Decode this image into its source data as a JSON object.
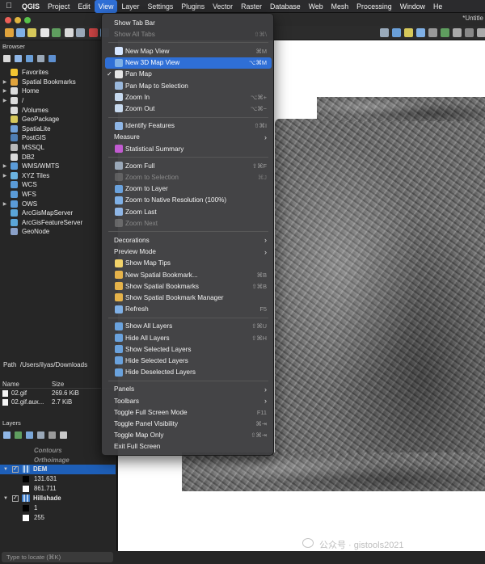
{
  "menubar": {
    "apple": "",
    "items": [
      "QGIS",
      "Project",
      "Edit",
      "View",
      "Layer",
      "Settings",
      "Plugins",
      "Vector",
      "Raster",
      "Database",
      "Web",
      "Mesh",
      "Processing",
      "Window",
      "He"
    ]
  },
  "window": {
    "title": "*Untitle"
  },
  "browser": {
    "title": "Browser",
    "items": [
      {
        "label": "Favorites",
        "arrow": "",
        "icon": "star-icon",
        "color": "#f3c531"
      },
      {
        "label": "Spatial Bookmarks",
        "arrow": "▶",
        "icon": "bookmark-icon",
        "color": "#e0a33c"
      },
      {
        "label": "Home",
        "arrow": "▶",
        "icon": "home-folder-icon",
        "color": "#dcdcdc"
      },
      {
        "label": "/",
        "arrow": "▶",
        "icon": "folder-icon",
        "color": "#dcdcdc"
      },
      {
        "label": "/Volumes",
        "arrow": "",
        "icon": "folder-icon",
        "color": "#dcdcdc"
      },
      {
        "label": "GeoPackage",
        "arrow": "",
        "icon": "geopackage-icon",
        "color": "#d6c85a"
      },
      {
        "label": "SpatiaLite",
        "arrow": "",
        "icon": "spatialite-icon",
        "color": "#6fa0d8"
      },
      {
        "label": "PostGIS",
        "arrow": "",
        "icon": "postgis-icon",
        "color": "#4f7fb5"
      },
      {
        "label": "MSSQL",
        "arrow": "",
        "icon": "mssql-icon",
        "color": "#b9b9b9"
      },
      {
        "label": "DB2",
        "arrow": "",
        "icon": "db2-icon",
        "color": "#d9d9d9"
      },
      {
        "label": "WMS/WMTS",
        "arrow": "▶",
        "icon": "wms-icon",
        "color": "#5a9bd8"
      },
      {
        "label": "XYZ Tiles",
        "arrow": "▶",
        "icon": "xyz-tiles-icon",
        "color": "#6bb3e0"
      },
      {
        "label": "WCS",
        "arrow": "",
        "icon": "wcs-icon",
        "color": "#5a9bd8"
      },
      {
        "label": "WFS",
        "arrow": "",
        "icon": "wfs-icon",
        "color": "#5a9bd8"
      },
      {
        "label": "OWS",
        "arrow": "▶",
        "icon": "ows-icon",
        "color": "#5a9bd8"
      },
      {
        "label": "ArcGisMapServer",
        "arrow": "",
        "icon": "arcgis-icon",
        "color": "#5aa5d8"
      },
      {
        "label": "ArcGisFeatureServer",
        "arrow": "",
        "icon": "arcgis-icon",
        "color": "#5aa5d8"
      },
      {
        "label": "GeoNode",
        "arrow": "",
        "icon": "geonode-icon",
        "color": "#8aa0c8"
      }
    ]
  },
  "path": {
    "label": "Path",
    "value": "/Users/ilyas/Downloads"
  },
  "files": {
    "headers": [
      "Name",
      "Size"
    ],
    "rows": [
      {
        "name": "02.gif",
        "size": "269.6 KiB"
      },
      {
        "name": "02.gif.aux...",
        "size": "2.7 KiB"
      }
    ]
  },
  "layers": {
    "title": "Layers",
    "rows": [
      {
        "label": "Contours",
        "type": "disabled"
      },
      {
        "label": "Orthoimage",
        "type": "disabled"
      },
      {
        "label": "DEM",
        "type": "raster-selected"
      },
      {
        "label": "131.631",
        "type": "legend",
        "color": "#000000"
      },
      {
        "label": "861.711",
        "type": "legend",
        "color": "#ffffff"
      },
      {
        "label": "Hillshade",
        "type": "raster"
      },
      {
        "label": "1",
        "type": "legend",
        "color": "#000000"
      },
      {
        "label": "255",
        "type": "legend",
        "color": "#ffffff"
      }
    ]
  },
  "locator": {
    "placeholder": "Type to locate (⌘K)"
  },
  "watermark": "公众号 · gistools2021",
  "viewMenu": {
    "items": [
      {
        "label": "Show Tab Bar",
        "shortcut": "",
        "enabled": true
      },
      {
        "label": "Show All Tabs",
        "shortcut": "⇧⌘\\",
        "enabled": false
      },
      {
        "sep": true
      },
      {
        "label": "New Map View",
        "shortcut": "⌘M",
        "enabled": true,
        "icon": "new-map-view-icon"
      },
      {
        "label": "New 3D Map View",
        "shortcut": "⌥⌘M",
        "enabled": true,
        "icon": "new-3d-map-view-icon",
        "highlight": true
      },
      {
        "label": "Pan Map",
        "shortcut": "",
        "enabled": true,
        "icon": "pan-hand-icon",
        "checked": true
      },
      {
        "label": "Pan Map to Selection",
        "shortcut": "",
        "enabled": true,
        "icon": "pan-to-selection-icon"
      },
      {
        "label": "Zoom In",
        "shortcut": "⌥⌘+",
        "enabled": true,
        "icon": "zoom-in-icon"
      },
      {
        "label": "Zoom Out",
        "shortcut": "⌥⌘−",
        "enabled": true,
        "icon": "zoom-out-icon"
      },
      {
        "sep": true
      },
      {
        "label": "Identify Features",
        "shortcut": "⇧⌘I",
        "enabled": true,
        "icon": "identify-icon"
      },
      {
        "label": "Measure",
        "submenu": true,
        "enabled": true
      },
      {
        "label": "Statistical Summary",
        "shortcut": "",
        "enabled": true,
        "icon": "statistics-icon"
      },
      {
        "sep": true
      },
      {
        "label": "Zoom Full",
        "shortcut": "⇧⌘F",
        "enabled": true,
        "icon": "zoom-full-icon"
      },
      {
        "label": "Zoom to Selection",
        "shortcut": "⌘J",
        "enabled": false,
        "icon": "zoom-to-selection-icon"
      },
      {
        "label": "Zoom to Layer",
        "shortcut": "",
        "enabled": true,
        "icon": "zoom-to-layer-icon"
      },
      {
        "label": "Zoom to Native Resolution (100%)",
        "shortcut": "",
        "enabled": true,
        "icon": "zoom-native-icon"
      },
      {
        "label": "Zoom Last",
        "shortcut": "",
        "enabled": true,
        "icon": "zoom-last-icon"
      },
      {
        "label": "Zoom Next",
        "shortcut": "",
        "enabled": false,
        "icon": "zoom-next-icon"
      },
      {
        "sep": true
      },
      {
        "label": "Decorations",
        "submenu": true,
        "enabled": true
      },
      {
        "label": "Preview Mode",
        "submenu": true,
        "enabled": true
      },
      {
        "label": "Show Map Tips",
        "shortcut": "",
        "enabled": true,
        "icon": "map-tips-icon"
      },
      {
        "label": "New Spatial Bookmark...",
        "shortcut": "⌘B",
        "enabled": true,
        "icon": "new-bookmark-icon"
      },
      {
        "label": "Show Spatial Bookmarks",
        "shortcut": "⇧⌘B",
        "enabled": true,
        "icon": "show-bookmarks-icon"
      },
      {
        "label": "Show Spatial Bookmark Manager",
        "shortcut": "",
        "enabled": true,
        "icon": "bookmark-manager-icon"
      },
      {
        "label": "Refresh",
        "shortcut": "F5",
        "enabled": true,
        "icon": "refresh-icon"
      },
      {
        "sep": true
      },
      {
        "label": "Show All Layers",
        "shortcut": "⇧⌘U",
        "enabled": true,
        "icon": "show-all-layers-icon"
      },
      {
        "label": "Hide All Layers",
        "shortcut": "⇧⌘H",
        "enabled": true,
        "icon": "hide-all-layers-icon"
      },
      {
        "label": "Show Selected Layers",
        "shortcut": "",
        "enabled": true,
        "icon": "show-selected-layers-icon"
      },
      {
        "label": "Hide Selected Layers",
        "shortcut": "",
        "enabled": true,
        "icon": "hide-selected-layers-icon"
      },
      {
        "label": "Hide Deselected Layers",
        "shortcut": "",
        "enabled": true,
        "icon": "hide-deselected-layers-icon"
      },
      {
        "sep": true
      },
      {
        "label": "Panels",
        "submenu": true,
        "enabled": true
      },
      {
        "label": "Toolbars",
        "submenu": true,
        "enabled": true
      },
      {
        "label": "Toggle Full Screen Mode",
        "shortcut": "F11",
        "enabled": true
      },
      {
        "label": "Toggle Panel Visibility",
        "shortcut": "⌘⇥",
        "enabled": true
      },
      {
        "label": "Toggle Map Only",
        "shortcut": "⇧⌘⇥",
        "enabled": true
      },
      {
        "label": "Exit Full Screen",
        "shortcut": "",
        "enabled": true
      }
    ]
  },
  "colors": {
    "menuHighlight": "#2f6fd6",
    "selectedLayer": "#1e5fb8"
  }
}
